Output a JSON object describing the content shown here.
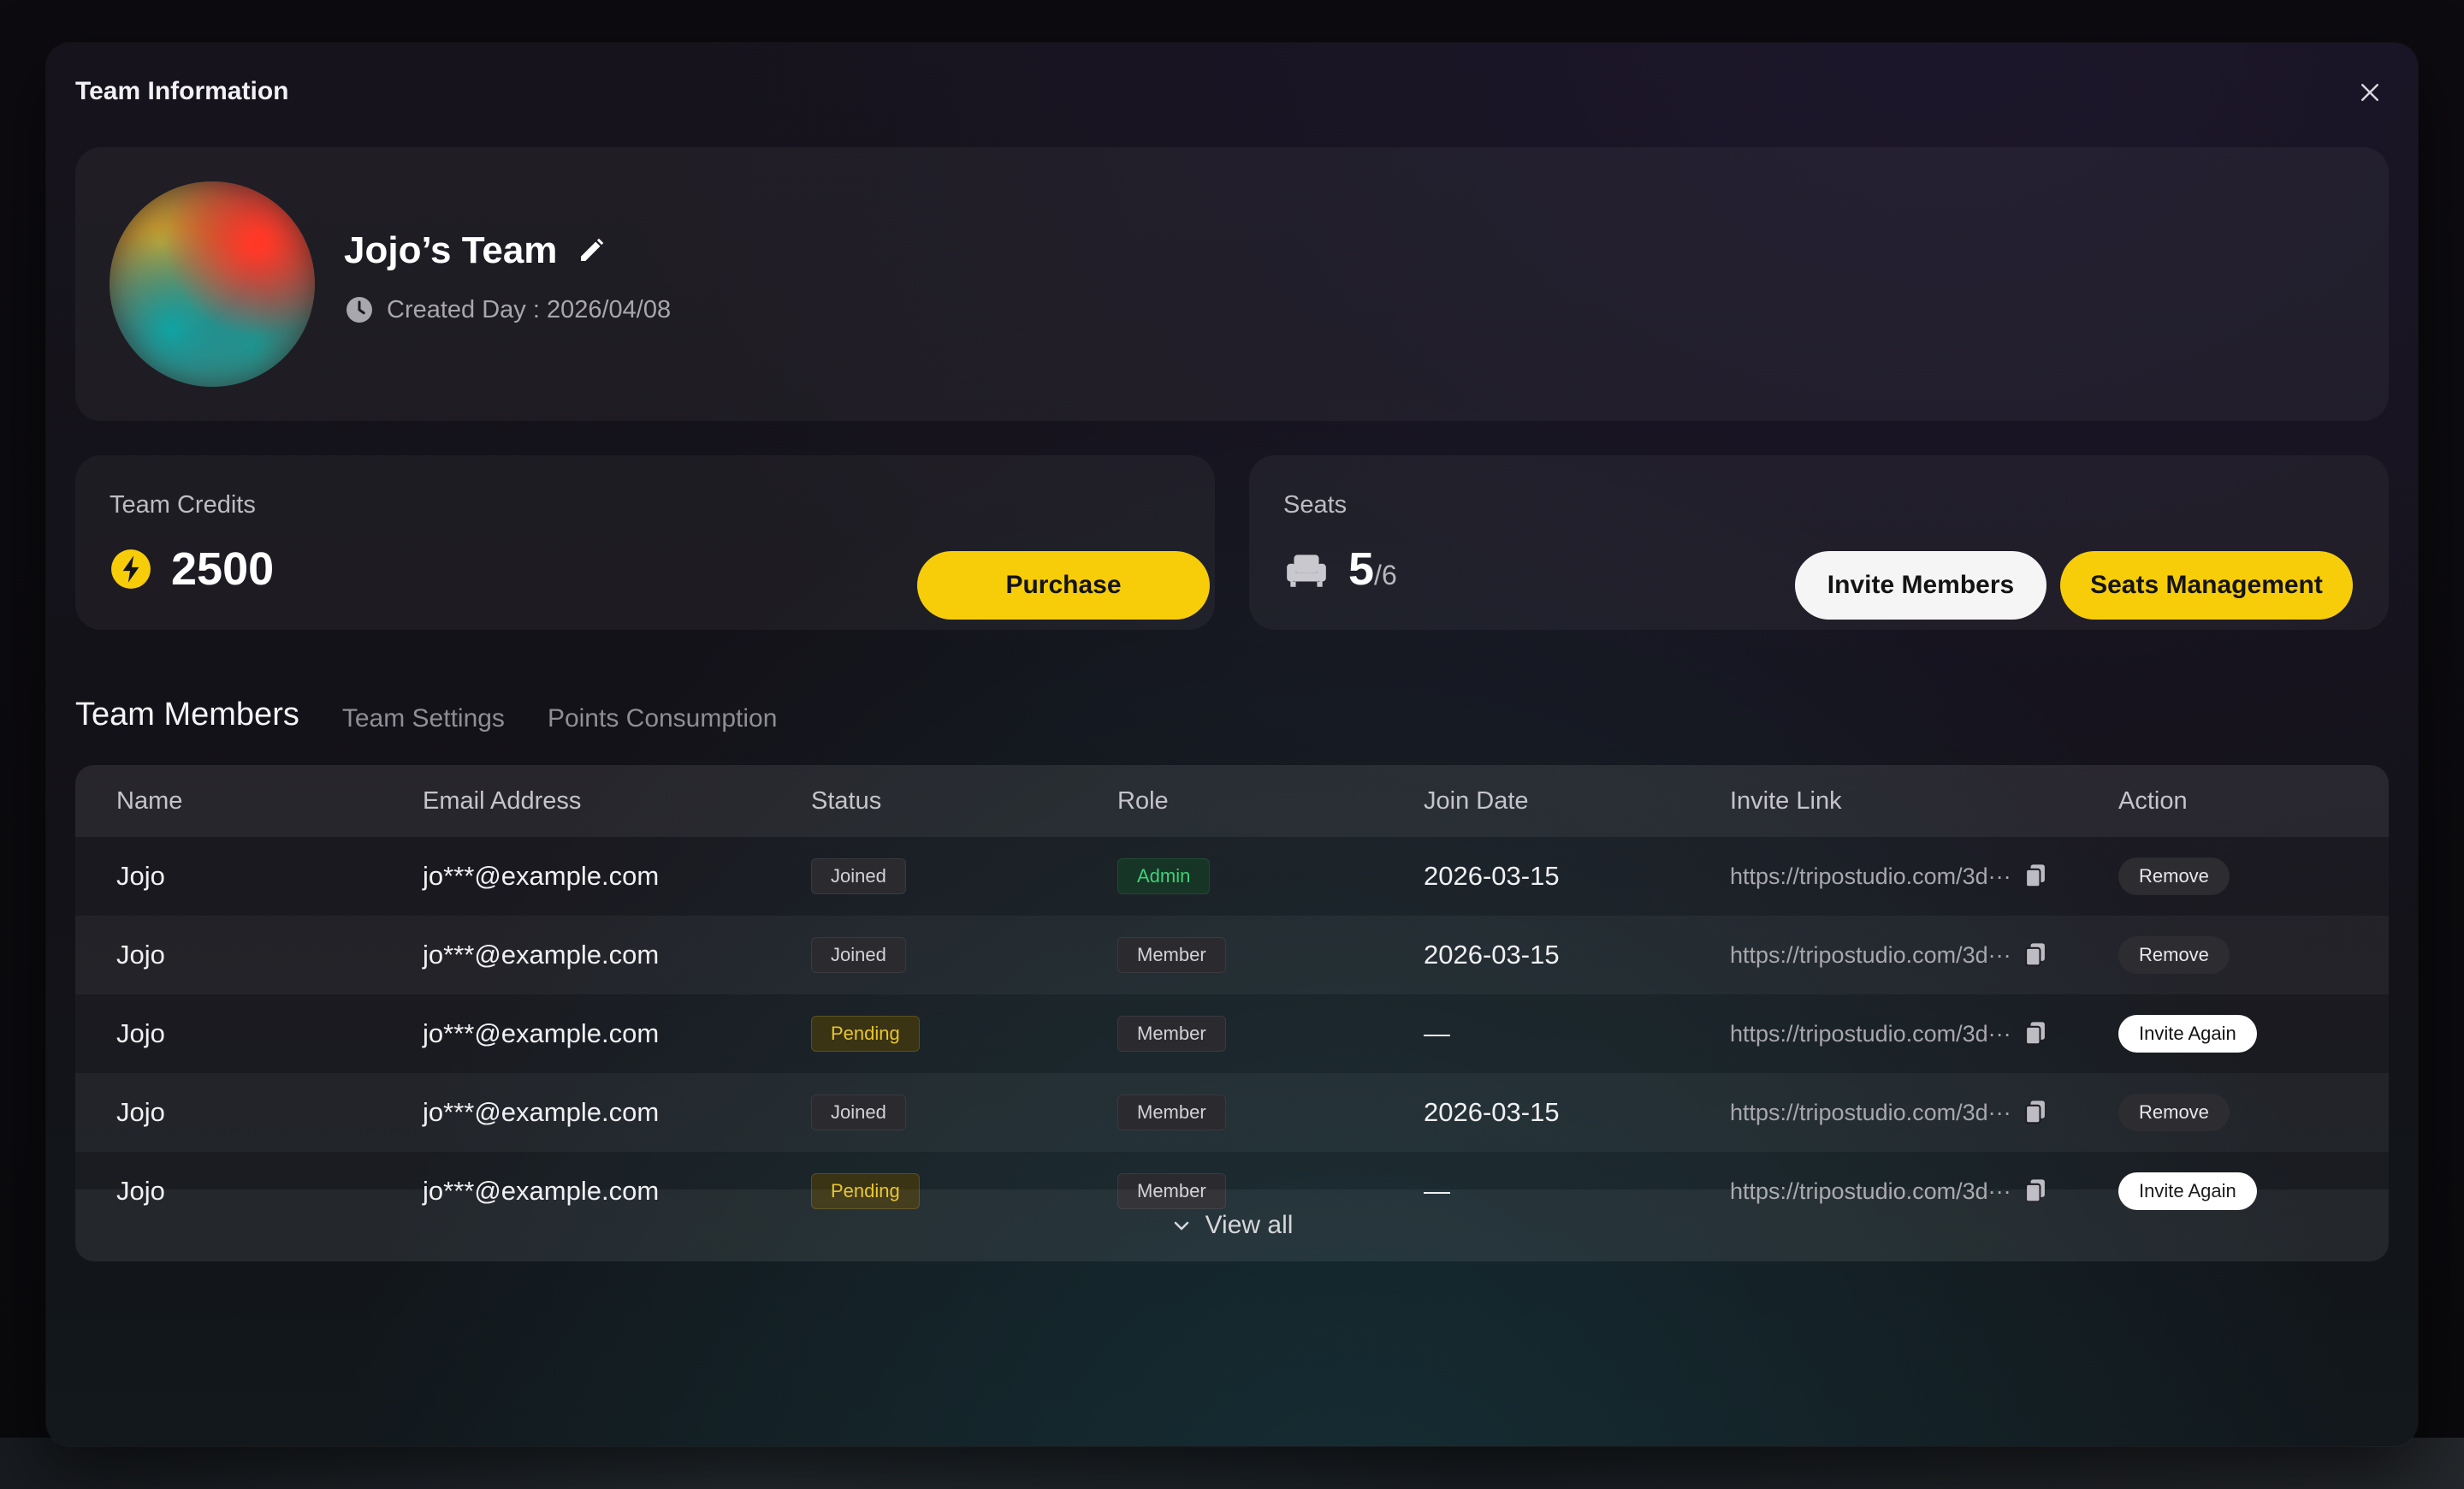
{
  "modal": {
    "title": "Team Information"
  },
  "team": {
    "name": "Jojo’s Team",
    "created": "Created Day : 2026/04/08"
  },
  "credits": {
    "label": "Team Credits",
    "value": "2500",
    "purchase_label": "Purchase"
  },
  "seats": {
    "label": "Seats",
    "used": "5",
    "total": "/6",
    "invite_label": "Invite Members",
    "manage_label": "Seats Management"
  },
  "tabs": [
    {
      "label": "Team Members",
      "active": true
    },
    {
      "label": "Team Settings",
      "active": false
    },
    {
      "label": "Points Consumption",
      "active": false
    }
  ],
  "table": {
    "headers": {
      "name": "Name",
      "email": "Email Address",
      "status": "Status",
      "role": "Role",
      "join_date": "Join Date",
      "invite_link": "Invite Link",
      "action": "Action"
    },
    "rows": [
      {
        "name": "Jojo",
        "email": "jo***@example.com",
        "status": "Joined",
        "role": "Admin",
        "join_date": "2026-03-15",
        "link": "https://tripostudio.com/3d···",
        "action": "Remove"
      },
      {
        "name": "Jojo",
        "email": "jo***@example.com",
        "status": "Joined",
        "role": "Member",
        "join_date": "2026-03-15",
        "link": "https://tripostudio.com/3d···",
        "action": "Remove"
      },
      {
        "name": "Jojo",
        "email": "jo***@example.com",
        "status": "Pending",
        "role": "Member",
        "join_date": "—",
        "link": "https://tripostudio.com/3d···",
        "action": "Invite Again"
      },
      {
        "name": "Jojo",
        "email": "jo***@example.com",
        "status": "Joined",
        "role": "Member",
        "join_date": "2026-03-15",
        "link": "https://tripostudio.com/3d···",
        "action": "Remove"
      },
      {
        "name": "Jojo",
        "email": "jo***@example.com",
        "status": "Pending",
        "role": "Member",
        "join_date": "—",
        "link": "https://tripostudio.com/3d···",
        "action": "Invite Again"
      }
    ],
    "view_all_label": "View all"
  },
  "icons": {
    "close": "close-icon",
    "edit": "pencil-icon",
    "clock": "clock-icon",
    "credits": "lightning-bolt-icon",
    "seats": "armchair-icon",
    "copy": "copy-icon",
    "view_all": "chevron-down-icon"
  },
  "colors": {
    "accent_yellow": "#f7cd0a",
    "admin_green": "#3fd079",
    "pending_yellow": "#e9c52a"
  }
}
